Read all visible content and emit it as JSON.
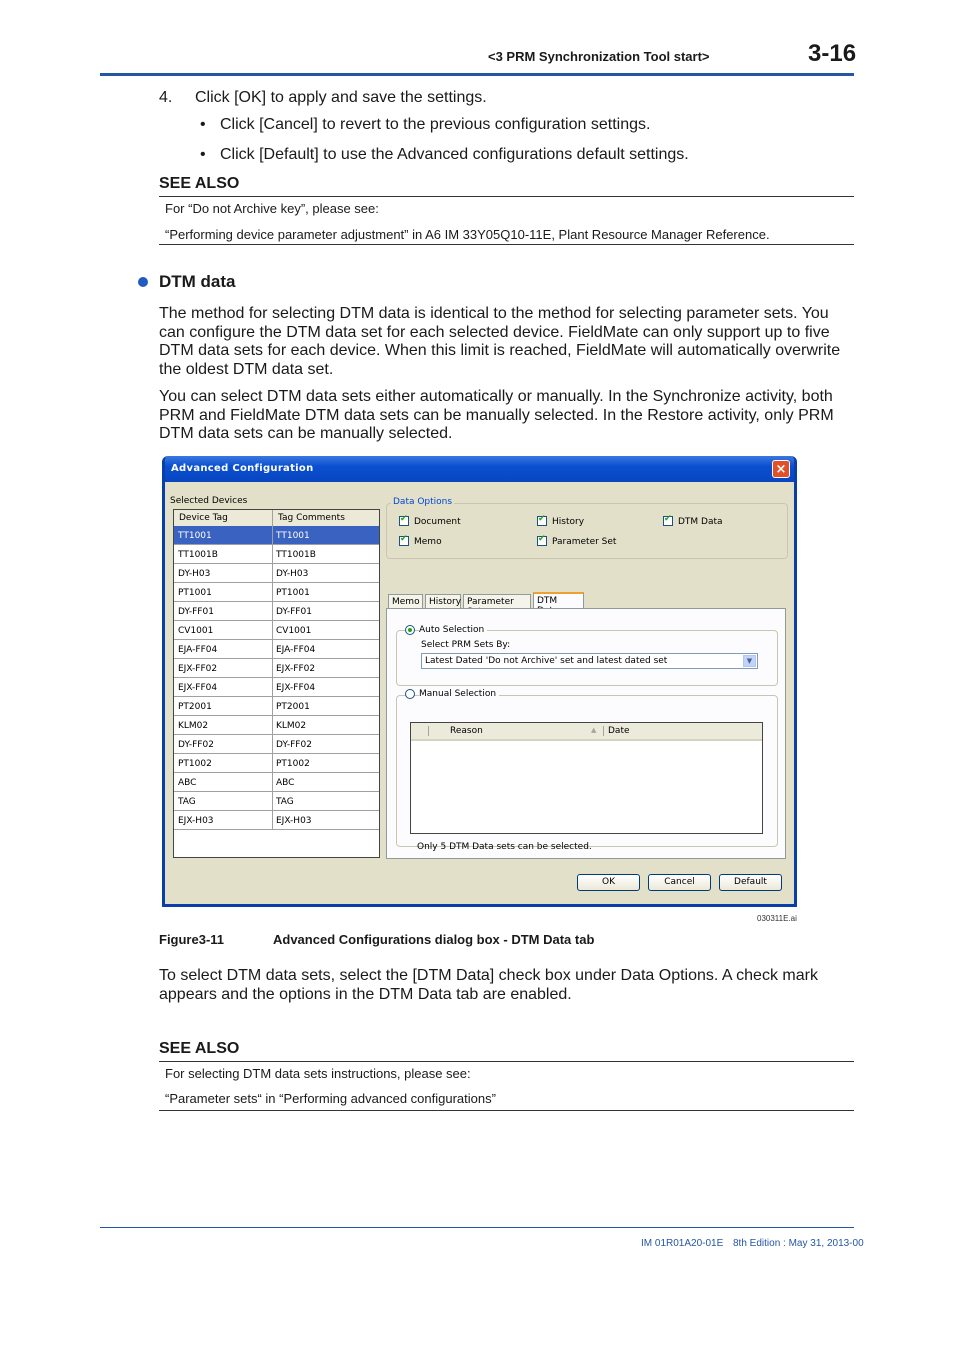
{
  "header": {
    "section": "<3  PRM Synchronization Tool start>",
    "page_number": "3-16"
  },
  "steps": {
    "step4_number": "4.",
    "step4_text": "Click [OK] to apply and save the settings.",
    "bullets": [
      "Click [Cancel] to revert to the previous configuration settings.",
      "Click [Default] to use the Advanced configurations default settings."
    ]
  },
  "see_also_1": {
    "heading": "SEE ALSO",
    "lines": [
      "For “Do not Archive key”, please see:",
      "“Performing device parameter adjustment” in A6 IM 33Y05Q10-11E, Plant Resource Manager Reference."
    ]
  },
  "section": {
    "heading": "DTM data",
    "paragraphs": [
      "The method for selecting DTM data is identical to the method for selecting parameter sets. You can configure the DTM data set for each selected device. FieldMate can only support up to five DTM data sets for each device. When this limit is reached, FieldMate will automatically overwrite the oldest DTM data set.",
      "You can select DTM data sets either automatically or manually. In the Synchronize activity, both PRM and FieldMate DTM data sets can be manually selected. In the Restore activity, only PRM DTM data sets can be manually selected."
    ]
  },
  "dialog": {
    "title": "Advanced Configuration",
    "close_icon": "×",
    "selected_devices_label": "Selected Devices",
    "columns": [
      "Device Tag",
      "Tag Comments"
    ],
    "devices": [
      [
        "TT1001",
        "TT1001"
      ],
      [
        "TT1001B",
        "TT1001B"
      ],
      [
        "DY-H03",
        "DY-H03"
      ],
      [
        "PT1001",
        "PT1001"
      ],
      [
        "DY-FF01",
        "DY-FF01"
      ],
      [
        "CV1001",
        "CV1001"
      ],
      [
        "EJA-FF04",
        "EJA-FF04"
      ],
      [
        "EJX-FF02",
        "EJX-FF02"
      ],
      [
        "EJX-FF04",
        "EJX-FF04"
      ],
      [
        "PT2001",
        "PT2001"
      ],
      [
        "KLM02",
        "KLM02"
      ],
      [
        "DY-FF02",
        "DY-FF02"
      ],
      [
        "PT1002",
        "PT1002"
      ],
      [
        "ABC",
        "ABC"
      ],
      [
        "TAG",
        "TAG"
      ],
      [
        "EJX-H03",
        "EJX-H03"
      ]
    ],
    "selected_device_index": 0,
    "data_options_label": "Data Options",
    "data_options": [
      {
        "label": "Document",
        "checked": true
      },
      {
        "label": "History",
        "checked": true
      },
      {
        "label": "DTM Data",
        "checked": true
      },
      {
        "label": "Memo",
        "checked": true
      },
      {
        "label": "Parameter Set",
        "checked": true
      }
    ],
    "tabs": [
      "Memo",
      "History",
      "Parameter Set",
      "DTM Data"
    ],
    "active_tab": "DTM Data",
    "auto_selection_label": "Auto Selection",
    "auto_selection_selected": true,
    "select_by_label": "Select PRM Sets By:",
    "select_by_value": "Latest Dated 'Do not Archive' set and latest dated set",
    "manual_selection_label": "Manual Selection",
    "manual_columns": [
      "Reason",
      "Date"
    ],
    "sort_icon": "▲",
    "limit_note": "Only 5 DTM Data sets can be selected.",
    "buttons": {
      "ok": "OK",
      "cancel": "Cancel",
      "default": "Default"
    }
  },
  "figure": {
    "file_id": "030311E.ai",
    "number": "Figure3-11",
    "caption": "Advanced Configurations dialog box - DTM Data tab"
  },
  "after_figure": "To select DTM data sets, select the [DTM Data] check box under Data Options. A check mark appears and the options in the DTM Data tab are enabled.",
  "see_also_2": {
    "heading": "SEE ALSO",
    "lines": [
      "For selecting DTM data sets instructions, please see:",
      "“Parameter sets“ in “Performing advanced configurations”"
    ]
  },
  "footer": {
    "doc_id": "IM 01R01A20-01E",
    "edition": "8th Edition : May 31, 2013-00"
  }
}
